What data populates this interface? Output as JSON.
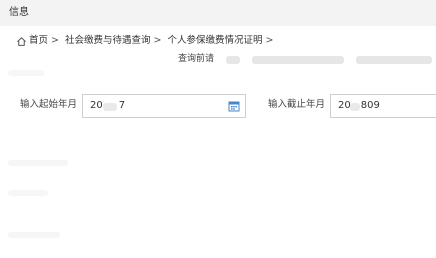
{
  "window": {
    "title": "信息"
  },
  "breadcrumb": [
    {
      "label": "首页"
    },
    {
      "label": "社会缴费与待遇查询"
    },
    {
      "label": "个人参保缴费情况证明"
    }
  ],
  "breadcrumb_separator": ">",
  "notice_text": "查询前请",
  "form": {
    "start": {
      "label": "输入起始年月",
      "value": "20",
      "value_tail": "7"
    },
    "end": {
      "label": "输入截止年月",
      "value": "20",
      "value_tail": "809"
    }
  },
  "icons": {
    "home": "home-icon",
    "calendar": "calendar-icon"
  },
  "colors": {
    "titlebar_bg": "#f3f3f3",
    "field_border": "#cfcfcf",
    "calendar_accent": "#4a86c8"
  }
}
